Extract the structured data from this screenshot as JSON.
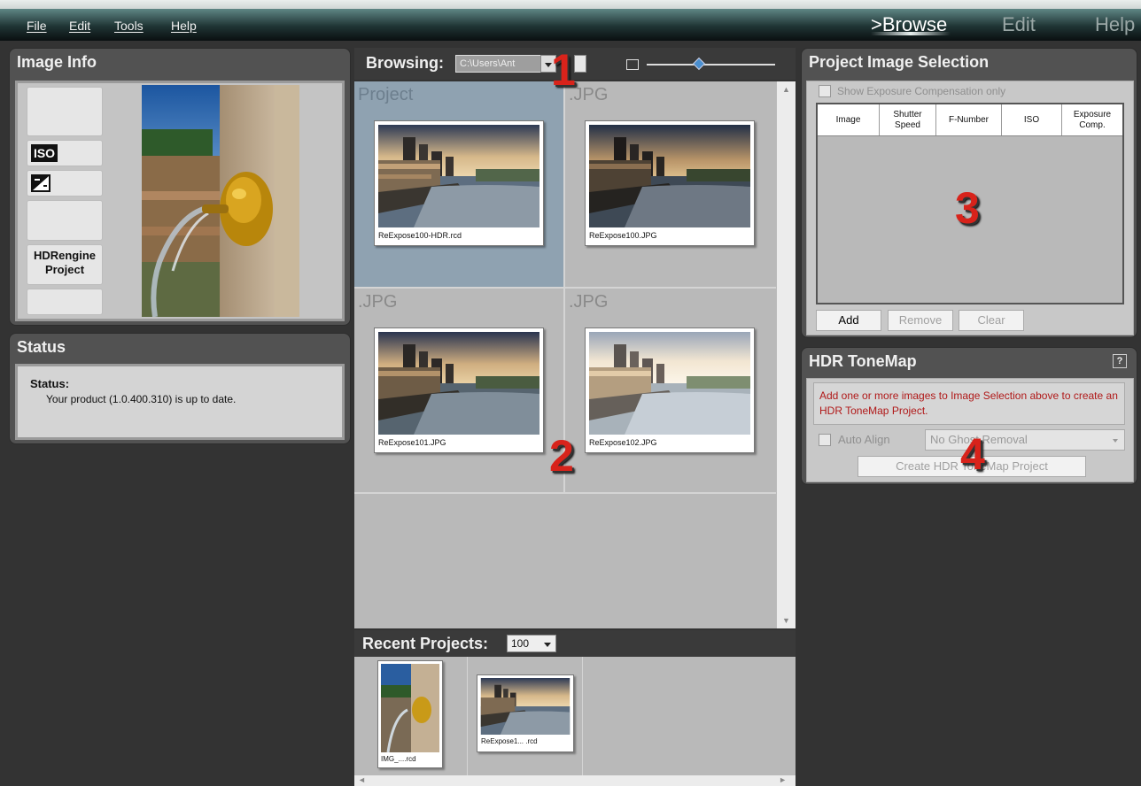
{
  "menu": {
    "items": [
      "File",
      "Edit",
      "Tools",
      "Help"
    ]
  },
  "nav": {
    "browse": ">Browse",
    "edit": "Edit",
    "help": "Help"
  },
  "image_info": {
    "title": "Image Info",
    "iso_icon": "ISO",
    "exposure_icon": "exposure-compensation-icon",
    "project_type": "HDRengine Project"
  },
  "status": {
    "title": "Status",
    "label": "Status:",
    "message": "Your product (1.0.400.310) is up to date."
  },
  "browsing": {
    "label": "Browsing:",
    "path": "C:\\Users\\Ant",
    "cells": [
      {
        "type": "Project",
        "filename": "ReExpose100-HDR.rcd",
        "selected": true
      },
      {
        "type": ".JPG",
        "filename": "ReExpose100.JPG",
        "selected": false
      },
      {
        "type": ".JPG",
        "filename": "ReExpose101.JPG",
        "selected": false
      },
      {
        "type": ".JPG",
        "filename": "ReExpose102.JPG",
        "selected": false
      }
    ]
  },
  "recent": {
    "label": "Recent Projects:",
    "count": "100",
    "items": [
      {
        "caption": "IMG_....rcd"
      },
      {
        "caption": "ReExpose1... .rcd"
      }
    ]
  },
  "project_selection": {
    "title": "Project Image Selection",
    "checkbox_label": "Show Exposure Compensation only",
    "columns": [
      "Image",
      "Shutter Speed",
      "F-Number",
      "ISO",
      "Exposure Comp."
    ],
    "add": "Add",
    "remove": "Remove",
    "clear": "Clear"
  },
  "tonemap": {
    "title": "HDR ToneMap",
    "help": "?",
    "message": "Add one or more images to Image Selection above to create an HDR ToneMap Project.",
    "auto_align": "Auto Align",
    "ghost": "No Ghost Removal",
    "create": "Create HDR ToneMap Project"
  },
  "markers": [
    "1",
    "2",
    "3",
    "4"
  ],
  "colors": {
    "marker": "#d8231b",
    "selected_cell": "#8fa2b1",
    "warning_text": "#b01818"
  }
}
